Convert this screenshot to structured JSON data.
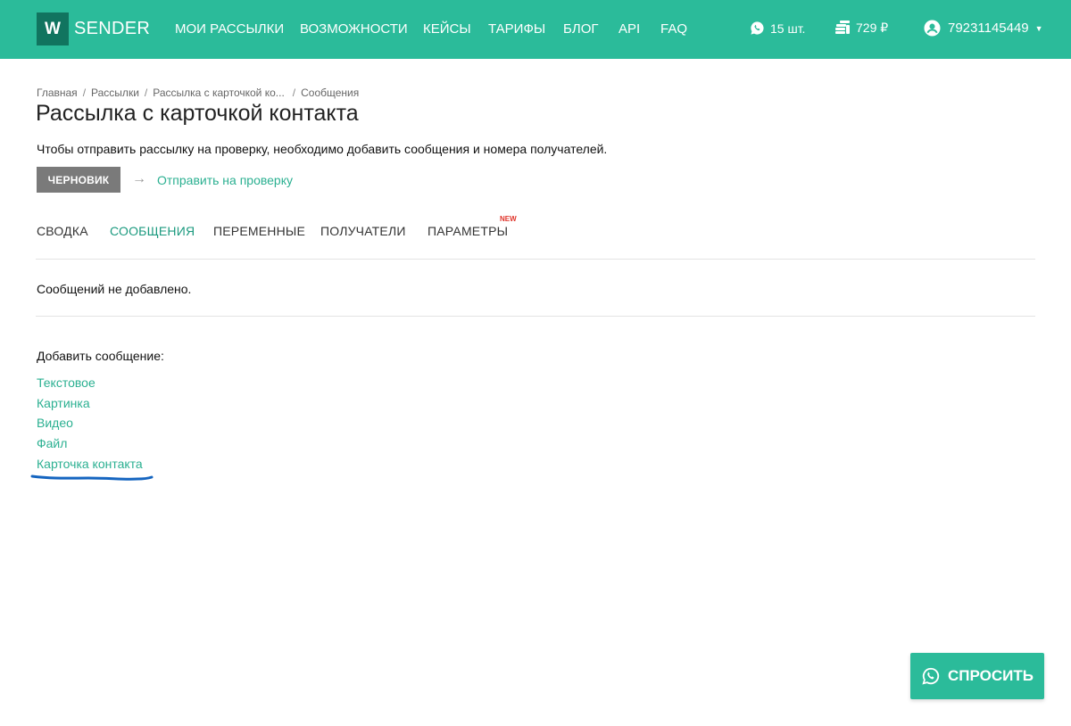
{
  "header": {
    "logo_letter": "W",
    "logo_text": "SENDER",
    "nav": [
      "МОИ РАССЫЛКИ",
      "ВОЗМОЖНОСТИ",
      "КЕЙСЫ",
      "ТАРИФЫ",
      "БЛОГ",
      "API",
      "FAQ"
    ],
    "messages_count": "15 шт.",
    "balance": "729 ₽",
    "user_phone": "79231145449"
  },
  "breadcrumb": [
    "Главная",
    "Рассылки",
    "Рассылка с карточкой ко...",
    "Сообщения"
  ],
  "page_title": "Рассылка с карточкой контакта",
  "notice": "Чтобы отправить рассылку на проверку, необходимо добавить сообщения и номера получателей.",
  "status": {
    "draft_label": "ЧЕРНОВИК",
    "arrow": "→",
    "send_link": "Отправить на проверку"
  },
  "tabs": [
    "СВОДКА",
    "СООБЩЕНИЯ",
    "ПЕРЕМЕННЫЕ",
    "ПОЛУЧАТЕЛИ",
    "ПАРАМЕТРЫ"
  ],
  "active_tab": "СООБЩЕНИЯ",
  "new_badge": "NEW",
  "empty_message": "Сообщений не добавлено.",
  "add_message_label": "Добавить сообщение:",
  "message_types": [
    "Текстовое",
    "Картинка",
    "Видео",
    "Файл",
    "Карточка контакта"
  ],
  "ask_button": "СПРОСИТЬ",
  "colors": {
    "brand": "#2bbb9a",
    "logo_box": "#11745f",
    "link": "#2bb091",
    "active_tab": "#1c9a7f",
    "draft": "#7a7a7a",
    "badge_new": "#e0342a",
    "annotation": "#1565c0"
  },
  "icons": {
    "messages": "whatsapp-icon",
    "balance": "coins-icon",
    "user": "user-circle-icon",
    "ask": "whatsapp-icon"
  }
}
